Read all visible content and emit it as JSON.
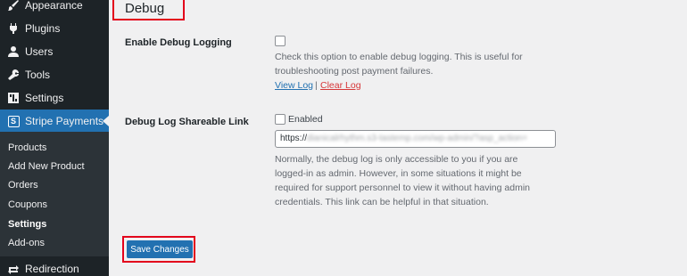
{
  "sidebar": {
    "items": [
      {
        "label": "Appearance",
        "icon": "brush-icon"
      },
      {
        "label": "Plugins",
        "icon": "plug-icon"
      },
      {
        "label": "Users",
        "icon": "user-icon"
      },
      {
        "label": "Tools",
        "icon": "wrench-icon"
      },
      {
        "label": "Settings",
        "icon": "settings-icon"
      },
      {
        "label": "Stripe Payments",
        "icon": "stripe-icon"
      }
    ],
    "submenu": [
      "Products",
      "Add New Product",
      "Orders",
      "Coupons",
      "Settings",
      "Add-ons"
    ],
    "active_submenu": "Settings",
    "bottom_item": {
      "label": "Redirection",
      "icon": "redirection-icon"
    }
  },
  "main": {
    "section_title": "Debug",
    "debug_logging": {
      "label": "Enable Debug Logging",
      "checked": false,
      "description": "Check this option to enable debug logging. This is useful for troubleshooting post payment failures.",
      "view_log_label": "View Log",
      "separator": "|",
      "clear_log_label": "Clear Log"
    },
    "shareable_link": {
      "label": "Debug Log Shareable Link",
      "checkbox_label": "Enabled",
      "checked": false,
      "url_prefix": "https://",
      "url_rest": "dianicalrhythm.s3-tastemp.com/wp-admin/?asp_action=",
      "description": "Normally, the debug log is only accessible to you if you are logged-in as admin. However, in some situations it might be required for support personnel to view it without having admin credentials. This link can be helpful in that situation."
    },
    "save_button_label": "Save Changes"
  },
  "colors": {
    "sidebar_bg": "#1d2327",
    "submenu_bg": "#2c3338",
    "accent": "#2271b1",
    "highlight_box": "#e3001b",
    "link": "#2271b1",
    "danger_link": "#d63638"
  }
}
